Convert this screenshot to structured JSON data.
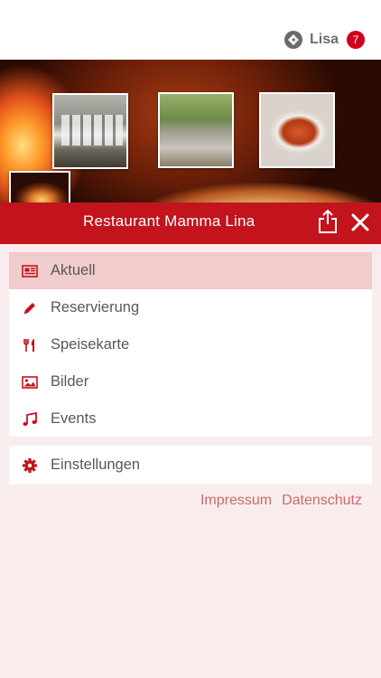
{
  "header": {
    "user_name": "Lisa",
    "notification_count": "7",
    "logo_icon": "app-logo-icon"
  },
  "hero": {
    "photos": [
      "staff-photo",
      "terrace-photo",
      "food-photo",
      "oven-photo"
    ]
  },
  "titlebar": {
    "title": "Restaurant Mamma Lina",
    "share_icon": "share-icon",
    "close_icon": "close-icon"
  },
  "menu": {
    "items": [
      {
        "label": "Aktuell",
        "icon": "newspaper-icon",
        "active": true
      },
      {
        "label": "Reservierung",
        "icon": "pencil-icon",
        "active": false
      },
      {
        "label": "Speisekarte",
        "icon": "fork-knife-icon",
        "active": false
      },
      {
        "label": "Bilder",
        "icon": "image-icon",
        "active": false
      },
      {
        "label": "Events",
        "icon": "music-note-icon",
        "active": false
      }
    ],
    "settings": {
      "label": "Einstellungen",
      "icon": "gear-icon"
    }
  },
  "footer": {
    "impressum": "Impressum",
    "datenschutz": "Datenschutz"
  },
  "colors": {
    "brand_red": "#c3141d",
    "badge_red": "#d0021b",
    "active_item_bg": "#f0cccd",
    "page_bg": "#f9ecec",
    "link_color": "#c86a6e"
  }
}
